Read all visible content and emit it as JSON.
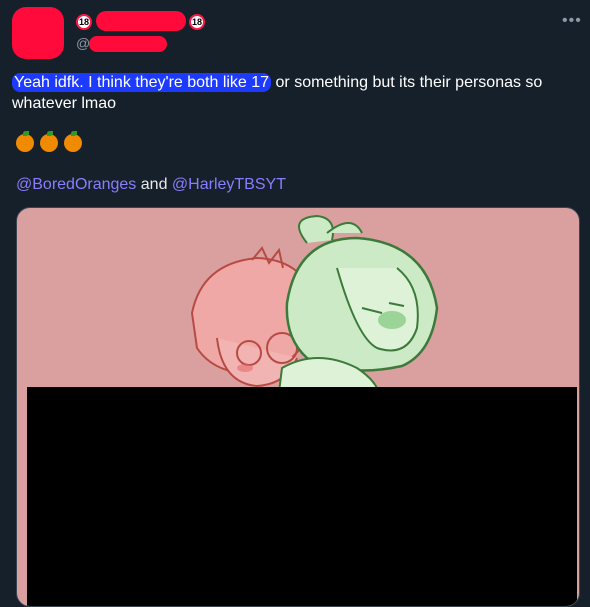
{
  "header": {
    "badge_text": "18",
    "at_symbol": "@",
    "more_icon": "more-horizontal-icon"
  },
  "tweet": {
    "highlighted_text": "Yeah idfk. I think they're both like 17",
    "rest_text": " or something but its their personas so whatever lmao",
    "emoji": [
      "orange",
      "orange",
      "orange"
    ],
    "mention1": "@BoredOranges",
    "and_text": "and",
    "mention2": "@HarleyTBSYT"
  },
  "colors": {
    "background": "#16202b",
    "redaction": "#ff0a3a",
    "highlight": "#1d3bff",
    "mention": "#8b7cff",
    "media_bg": "#d9a09f"
  }
}
